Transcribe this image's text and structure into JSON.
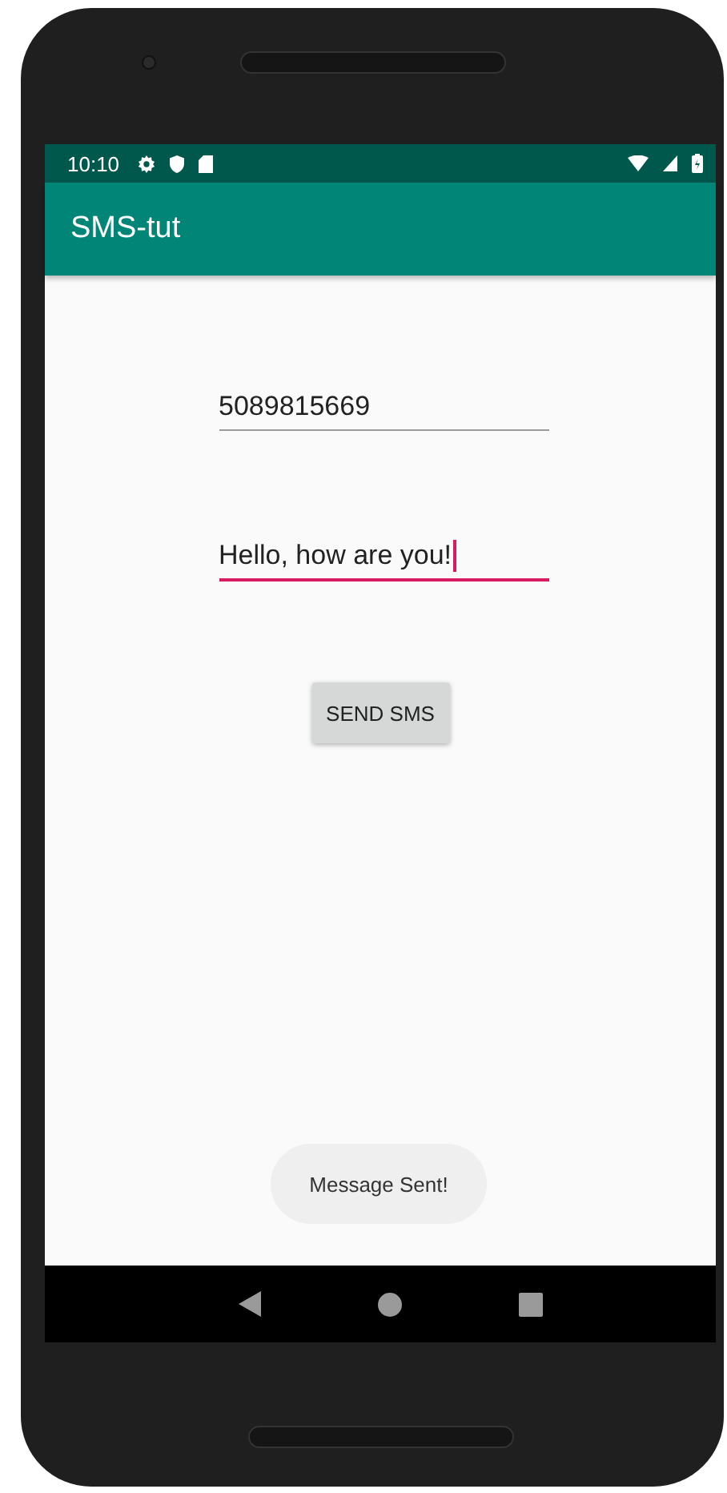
{
  "status_bar": {
    "time": "10:10"
  },
  "app_bar": {
    "title": "SMS-tut"
  },
  "fields": [
    {
      "value": "5089815669",
      "focused": false
    },
    {
      "value": "Hello, how are you!",
      "focused": true
    }
  ],
  "button": {
    "label": "SEND SMS"
  },
  "toast": {
    "text": "Message Sent!"
  }
}
